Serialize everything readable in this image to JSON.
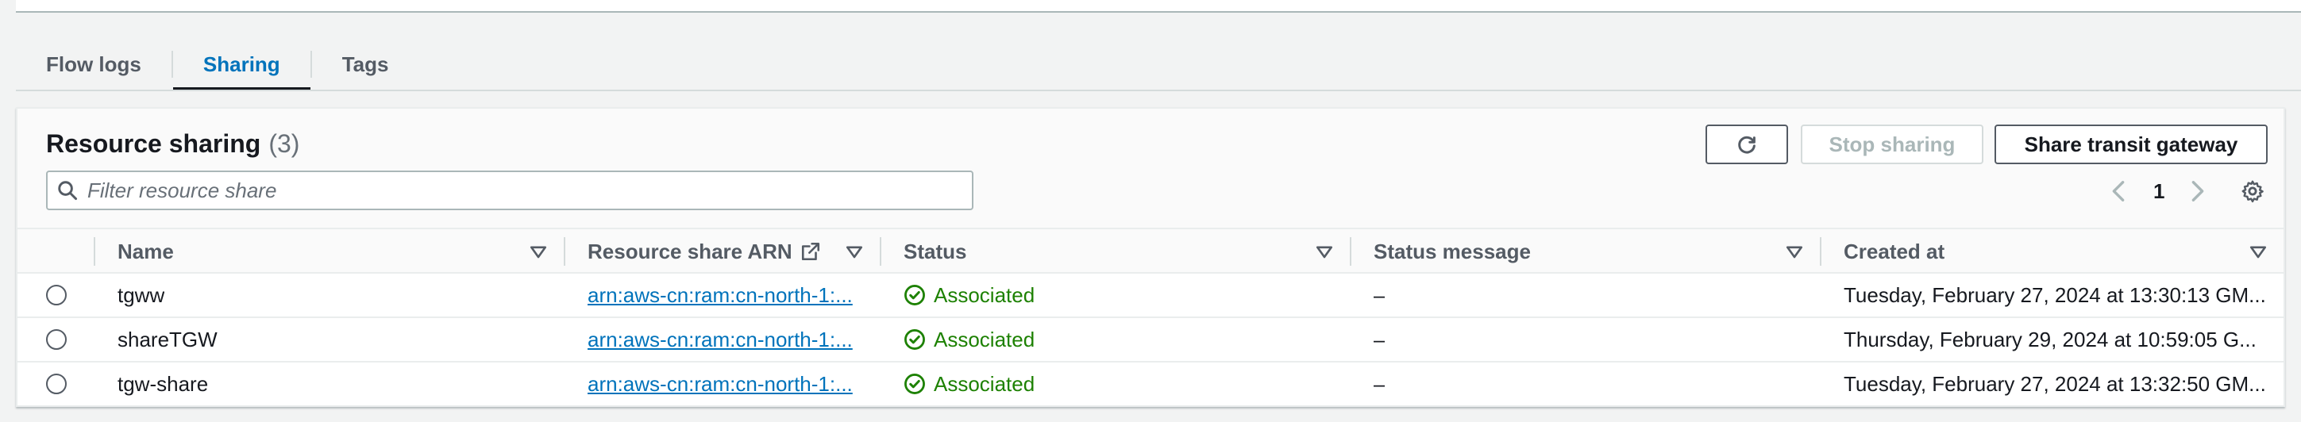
{
  "tabs": [
    {
      "label": "Flow logs",
      "active": false
    },
    {
      "label": "Sharing",
      "active": true
    },
    {
      "label": "Tags",
      "active": false
    }
  ],
  "panel": {
    "title": "Resource sharing",
    "count": "(3)",
    "buttons": {
      "refresh_icon": "refresh-icon",
      "stop_sharing": "Stop sharing",
      "share_tgw": "Share transit gateway"
    },
    "filter": {
      "placeholder": "Filter resource share",
      "value": ""
    },
    "pagination": {
      "current_page": "1"
    }
  },
  "table": {
    "columns": [
      "Name",
      "Resource share ARN",
      "Status",
      "Status message",
      "Created at"
    ],
    "rows": [
      {
        "name": "tgww",
        "arn": "arn:aws-cn:ram:cn-north-1:...",
        "status": "Associated",
        "message": "–",
        "created": "Tuesday, February 27, 2024 at 13:30:13 GM..."
      },
      {
        "name": "shareTGW",
        "arn": "arn:aws-cn:ram:cn-north-1:...",
        "status": "Associated",
        "message": "–",
        "created": "Thursday, February 29, 2024 at 10:59:05 G..."
      },
      {
        "name": "tgw-share",
        "arn": "arn:aws-cn:ram:cn-north-1:...",
        "status": "Associated",
        "message": "–",
        "created": "Tuesday, February 27, 2024 at 13:32:50 GM..."
      }
    ]
  },
  "colors": {
    "accent": "#0073bb",
    "success": "#1d8102",
    "text": "#16191f",
    "muted": "#545b64"
  }
}
